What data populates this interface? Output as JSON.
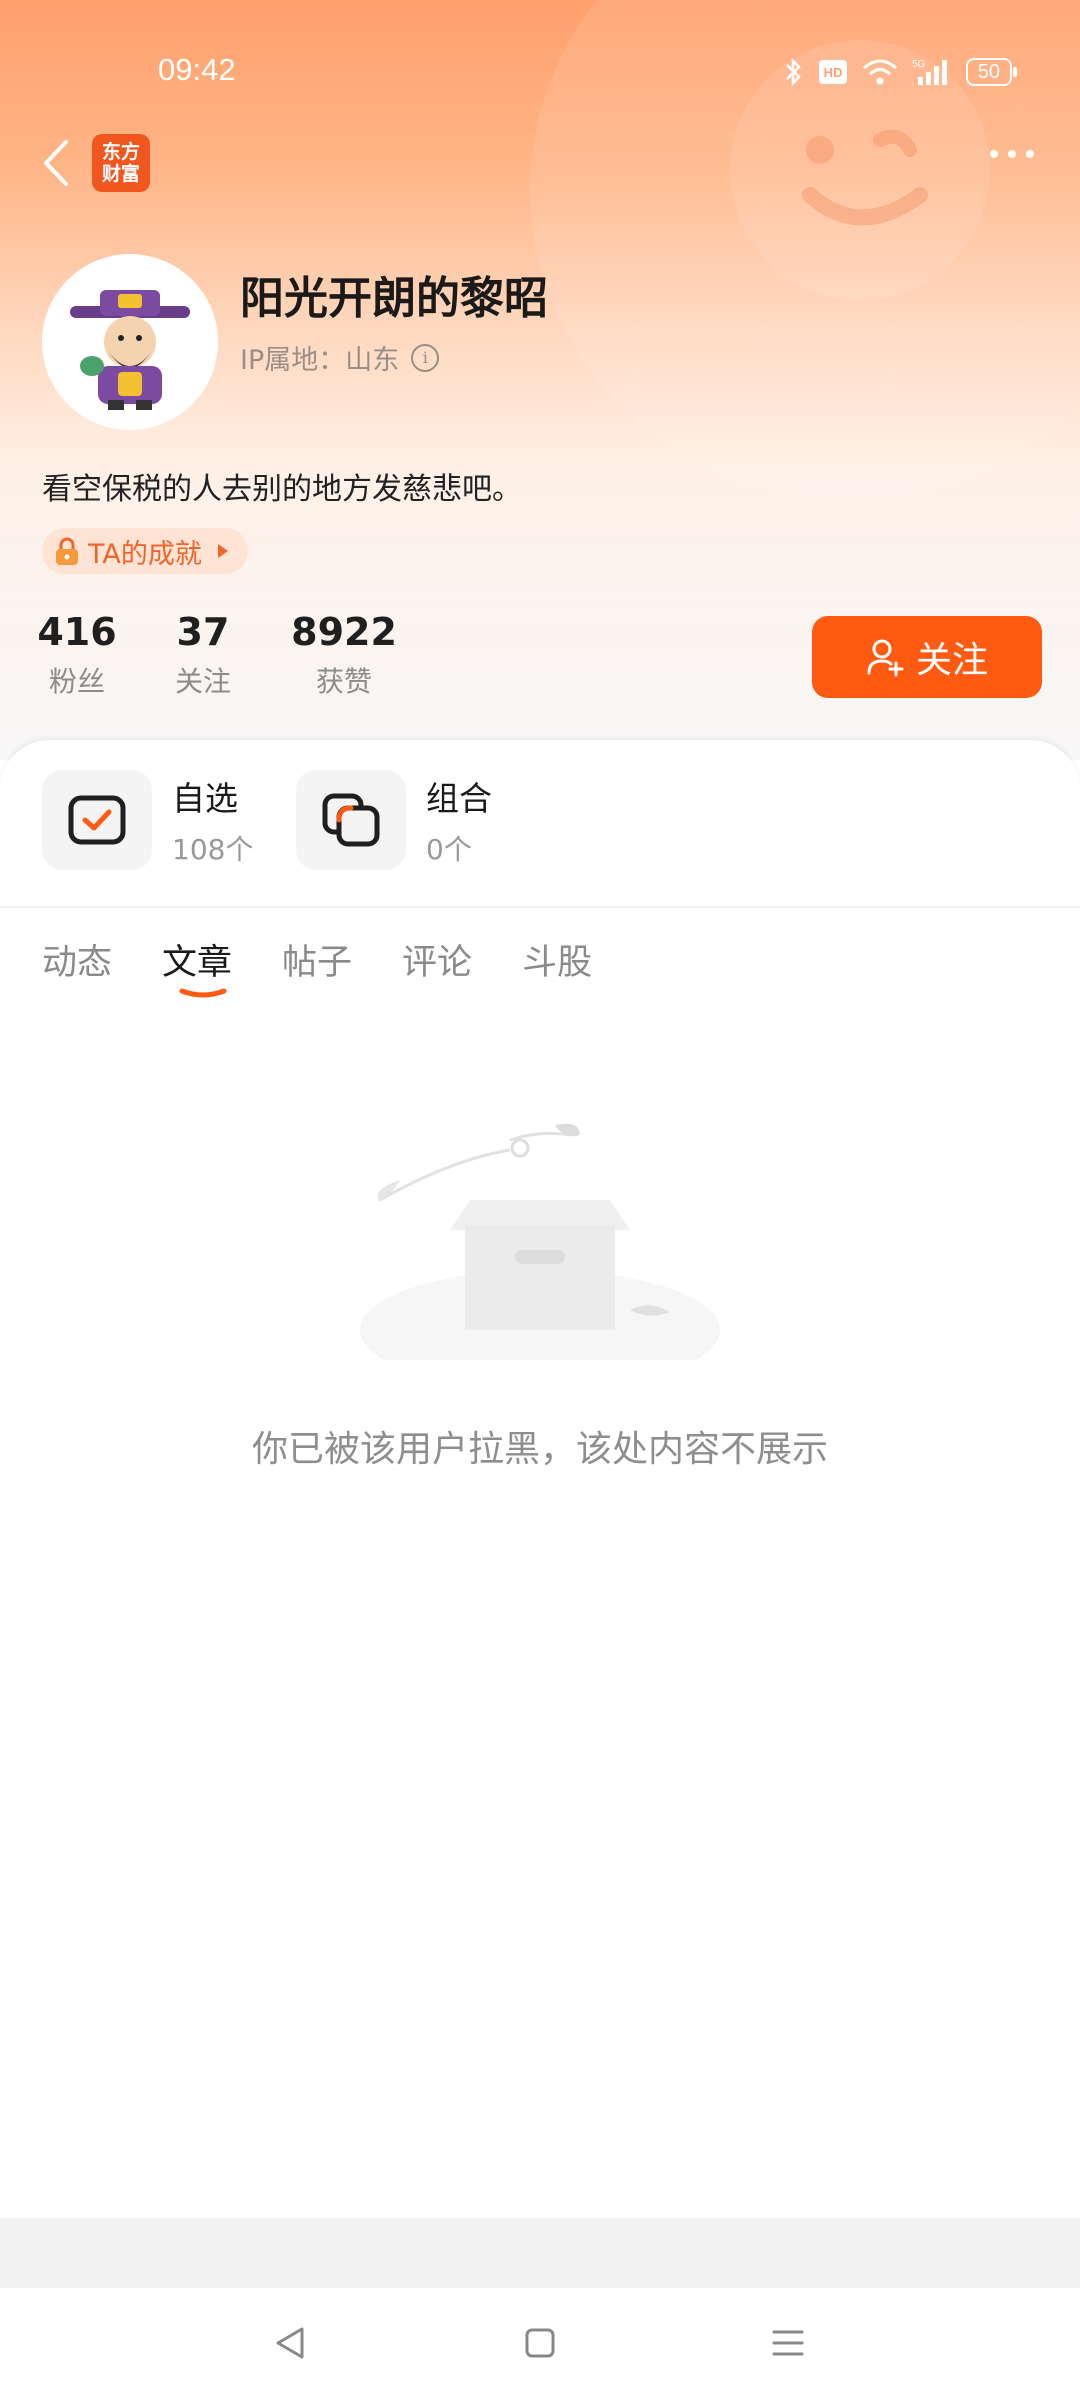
{
  "status_bar": {
    "time": "09:42",
    "battery": "50",
    "network": "5G"
  },
  "header": {
    "app_logo_text": "东方财富",
    "more_icon": "more-horizontal-icon"
  },
  "profile": {
    "name": "阳光开朗的黎昭",
    "ip_location": "IP属地：山东",
    "bio": "看空保税的人去别的地方发慈悲吧。",
    "achievement_label": "TA的成就",
    "stats": [
      {
        "value": "416",
        "label": "粉丝"
      },
      {
        "value": "37",
        "label": "关注"
      },
      {
        "value": "8922",
        "label": "获赞"
      }
    ],
    "follow_button": "关注"
  },
  "features": [
    {
      "title": "自选",
      "count": "108个",
      "icon": "watchlist-check-icon"
    },
    {
      "title": "组合",
      "count": "0个",
      "icon": "portfolio-overlap-icon"
    }
  ],
  "tabs": [
    {
      "label": "动态",
      "active": false
    },
    {
      "label": "文章",
      "active": true
    },
    {
      "label": "帖子",
      "active": false
    },
    {
      "label": "评论",
      "active": false
    },
    {
      "label": "斗股",
      "active": false
    }
  ],
  "empty_state": {
    "message": "你已被该用户拉黑，该处内容不展示",
    "icon": "empty-box-icon"
  },
  "colors": {
    "accent": "#ff5a12",
    "header_gradient_top": "#ffa06d"
  }
}
